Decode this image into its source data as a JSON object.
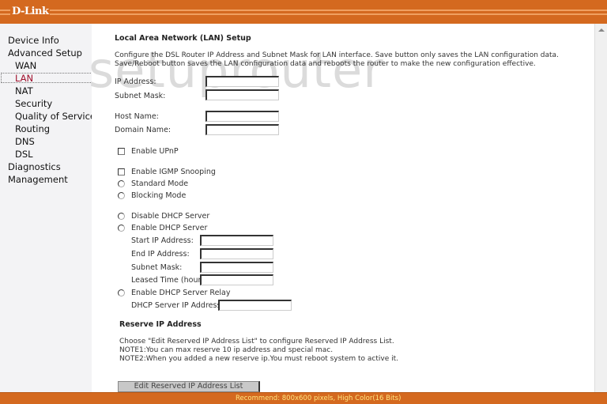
{
  "header": {
    "logo": "D-Link"
  },
  "sidebar": {
    "items": [
      {
        "label": "Device Info",
        "level": 0,
        "active": false
      },
      {
        "label": "Advanced Setup",
        "level": 0,
        "active": false
      },
      {
        "label": "WAN",
        "level": 1,
        "active": false
      },
      {
        "label": "LAN",
        "level": 1,
        "active": true
      },
      {
        "label": "NAT",
        "level": 1,
        "active": false
      },
      {
        "label": "Security",
        "level": 1,
        "active": false
      },
      {
        "label": "Quality of Service",
        "level": 1,
        "active": false
      },
      {
        "label": "Routing",
        "level": 1,
        "active": false
      },
      {
        "label": "DNS",
        "level": 1,
        "active": false
      },
      {
        "label": "DSL",
        "level": 1,
        "active": false
      },
      {
        "label": "Diagnostics",
        "level": 0,
        "active": false
      },
      {
        "label": "Management",
        "level": 0,
        "active": false
      }
    ]
  },
  "watermark": "setuprouter",
  "main": {
    "title": "Local Area Network (LAN) Setup",
    "description": "Configure the DSL Router IP Address and Subnet Mask for LAN interface.  Save button only saves the LAN configuration data.  Save/Reboot button saves the LAN configuration data and reboots the router to make the new configuration effective.",
    "ip_address_label": "IP Address:",
    "ip_address_value": "",
    "subnet_mask_label": "Subnet Mask:",
    "subnet_mask_value": "",
    "host_name_label": "Host Name:",
    "host_name_value": "",
    "domain_name_label": "Domain Name:",
    "domain_name_value": "",
    "enable_upnp_label": "Enable UPnP",
    "enable_upnp_checked": false,
    "enable_igmp_label": "Enable IGMP Snooping",
    "enable_igmp_checked": false,
    "standard_mode_label": "Standard Mode",
    "blocking_mode_label": "Blocking Mode",
    "disable_dhcp_label": "Disable DHCP Server",
    "enable_dhcp_label": "Enable DHCP Server",
    "start_ip_label": "Start IP Address:",
    "start_ip_value": "",
    "end_ip_label": "End IP Address:",
    "end_ip_value": "",
    "dhcp_subnet_label": "Subnet Mask:",
    "dhcp_subnet_value": "",
    "lease_time_label": "Leased Time (hour):",
    "lease_time_value": "",
    "dhcp_relay_label": "Enable DHCP Server Relay",
    "dhcp_server_ip_label": "DHCP Server IP Address:",
    "dhcp_server_ip_value": "",
    "reserve_title": "Reserve IP Address",
    "reserve_line1": "Choose \"Edit Reserved IP Address List\" to configure Reserved IP Address List.",
    "reserve_line2": "NOTE1:You can max reserve 10 ip address and special mac.",
    "reserve_line3": "NOTE2:When you added a new reserve ip.You must reboot system to active it.",
    "edit_reserved_button": "Edit Reserved IP Address List"
  },
  "footer": {
    "recommend": "Recommend: 800x600 pixels, High Color(16 Bits)"
  },
  "colors": {
    "brand_orange": "#d4691f",
    "active_nav": "#a0102c",
    "footer_text": "#ffe680"
  }
}
